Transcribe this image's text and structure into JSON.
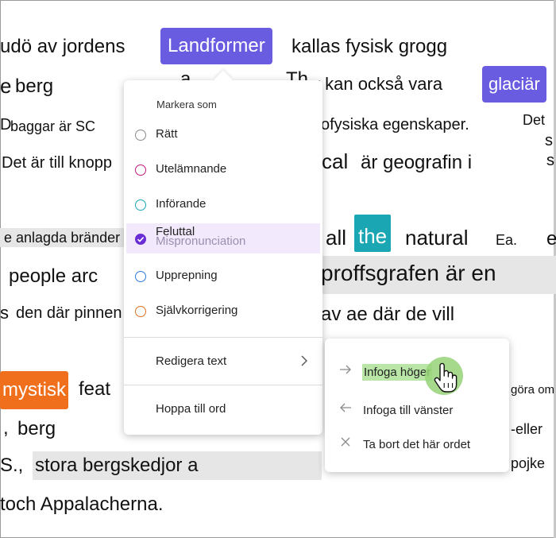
{
  "words": {
    "l1a": "udö av jordens",
    "l1b": "Landformer",
    "l1c": "kallas fysisk grogg",
    "l2a": "e",
    "l2b": "berg",
    "l2c": "a",
    "l2d": "Th",
    "l2e": "y kan också vara",
    "l2f": "glaciär",
    "l3a": "D",
    "l3b": "baggar är SC",
    "l3c": "ofysiska egenskaper.",
    "l3d": "Det",
    "l3e": "s",
    "l4a": "Det är till knopp",
    "l4b": "cal",
    "l4c": "är geografin i",
    "l4d": "s",
    "l5a": "e anlagda bränder",
    "l5b": "all",
    "l5c": "the",
    "l5d": "natural",
    "l5e": "Ea.",
    "l5f": "e",
    "l6a": "people arc",
    "l6b": "proffsgrafen är en",
    "l7a": "s",
    "l7b": "den där pinnen",
    "l7c": "av ae där de vill",
    "l8a": "mystisk",
    "l8b": "feat",
    "l8c": "göra om",
    "l9a": ",",
    "l9b": "berg",
    "l9c": "-eller",
    "l10a": "S.,",
    "l10b": "stora bergskedjor a",
    "l10c": "pojke",
    "l11a": "toch Appalacherna."
  },
  "menu": {
    "header": "Markera som",
    "items": [
      {
        "label": "Rätt",
        "color": "#8a8a8a",
        "checked": false
      },
      {
        "label": "Utelämnande",
        "color": "#c2187a",
        "checked": false
      },
      {
        "label": "Införande",
        "color": "#1aa7b3",
        "checked": false
      },
      {
        "label": "Feluttal",
        "overlap_label": "Mispronunciation",
        "color": "#6a2fd4",
        "checked": true
      },
      {
        "label": "Upprepning",
        "color": "#2b7bd8",
        "checked": false
      },
      {
        "label": "Självkorrigering",
        "color": "#e07020",
        "checked": false
      }
    ],
    "edit_text": "Redigera text",
    "skip_to_word": "Hoppa till ord"
  },
  "submenu": {
    "insert_right": "Infoga höger",
    "insert_left": "Infoga till vänster",
    "delete_word": "Ta bort det här ordet"
  },
  "icons": {
    "insert_right": "arrow-right-icon",
    "insert_left": "arrow-left-icon",
    "delete_word": "close-icon",
    "submenu_chevron": "chevron-right-icon",
    "cursor": "hand-pointer-icon"
  },
  "colors": {
    "highlight_purple": "#6a5ce0",
    "highlight_teal": "#1aa7b3",
    "highlight_orange": "#f06f1c",
    "selected_row": "#f2eafc",
    "hover_green": "#b9e6a6"
  }
}
